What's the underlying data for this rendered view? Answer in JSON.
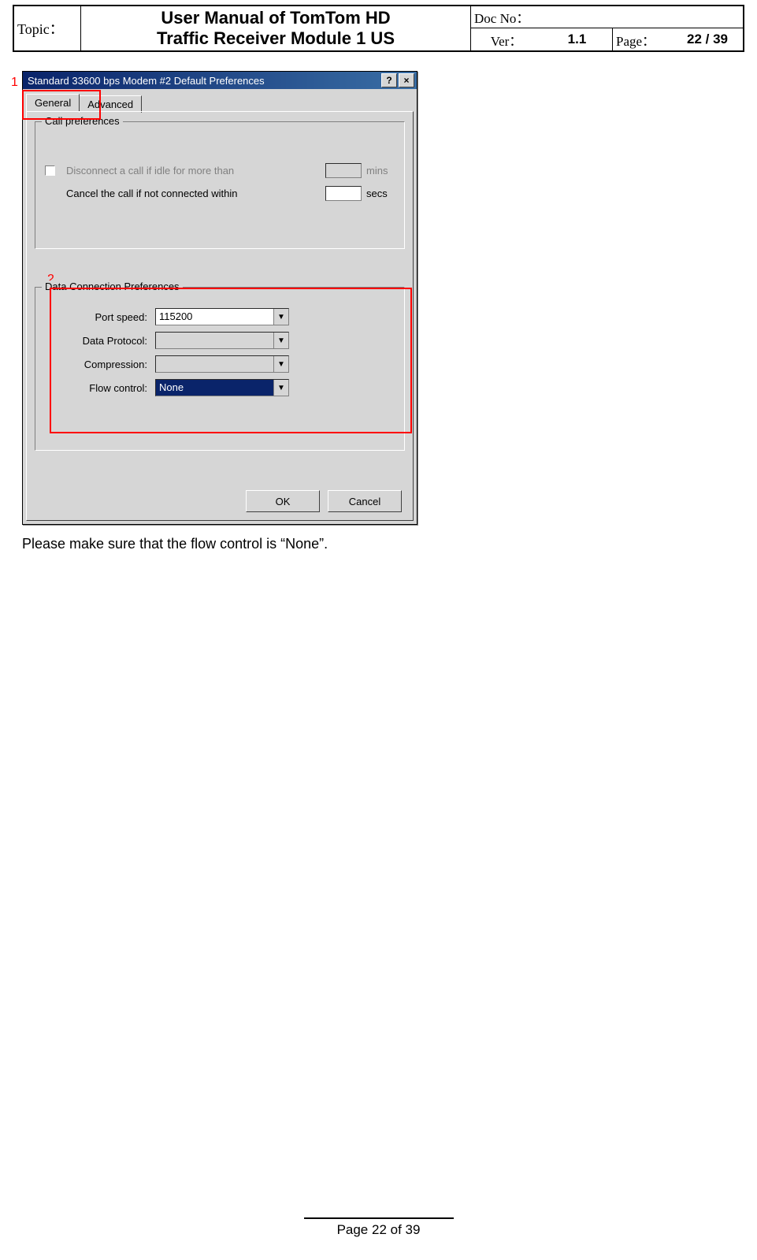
{
  "header": {
    "topic_label": "Topic：",
    "title_line1": "User Manual of TomTom HD",
    "title_line2": "Traffic Receiver Module 1 US",
    "docno_label": "Doc No：",
    "docno_value": "",
    "ver_label": "Ver：",
    "ver_value": "1.1",
    "page_label": "Page：",
    "page_value": "22 / 39"
  },
  "callouts": {
    "c1": "1",
    "c2": "2"
  },
  "dialog": {
    "title": "Standard 33600 bps Modem #2 Default Preferences",
    "help_glyph": "?",
    "close_glyph": "×",
    "tabs": {
      "general": "General",
      "advanced": "Advanced"
    },
    "call_prefs": {
      "legend": "Call preferences",
      "disconnect_label": "Disconnect a call if idle for more than",
      "disconnect_unit": "mins",
      "cancel_label": "Cancel the call if not connected within",
      "cancel_unit": "secs"
    },
    "data_prefs": {
      "legend": "Data Connection Preferences",
      "port_speed_label": "Port speed:",
      "port_speed_value": "115200",
      "data_protocol_label": "Data Protocol:",
      "data_protocol_value": "",
      "compression_label": "Compression:",
      "compression_value": "",
      "flow_control_label": "Flow control:",
      "flow_control_value": "None"
    },
    "buttons": {
      "ok": "OK",
      "cancel": "Cancel"
    },
    "dropdown_glyph": "▼"
  },
  "body_text": "Please make sure that the flow control is “None”.",
  "footer": "Page 22 of 39"
}
